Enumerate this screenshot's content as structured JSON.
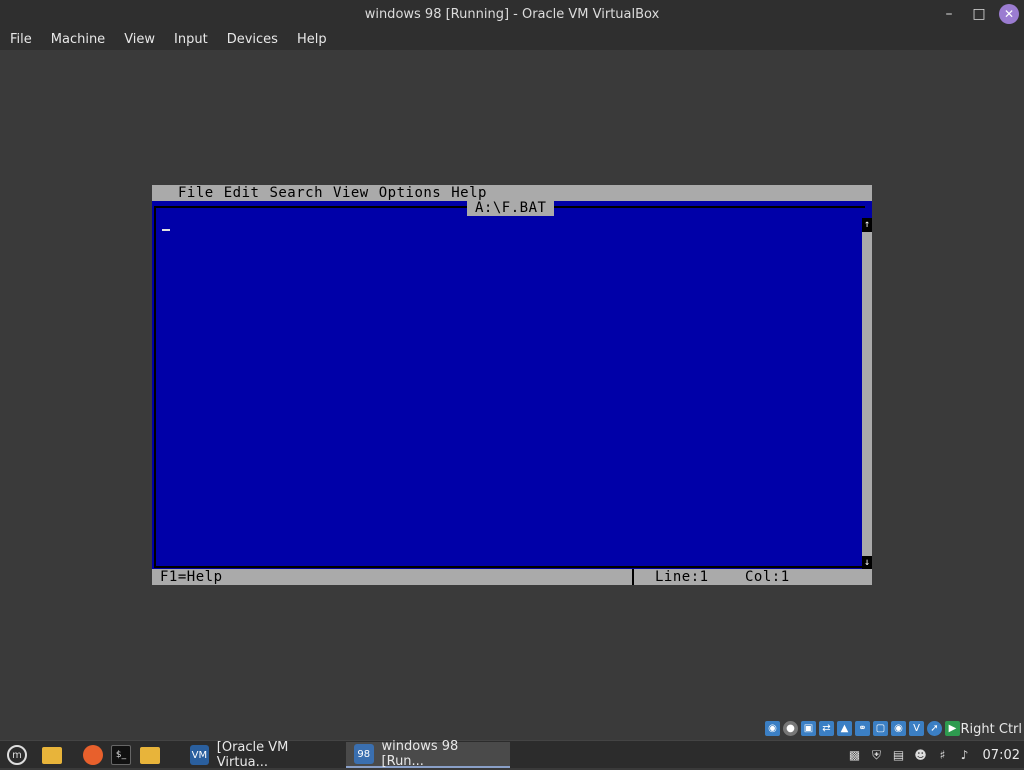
{
  "window": {
    "title": "windows 98 [Running] - Oracle VM VirtualBox",
    "minimize_icon": "minimize-icon",
    "maximize_icon": "maximize-icon",
    "close_icon": "close-icon"
  },
  "host_menu": [
    "File",
    "Machine",
    "View",
    "Input",
    "Devices",
    "Help"
  ],
  "dos_editor": {
    "menu": [
      "File",
      "Edit",
      "Search",
      "View",
      "Options",
      "Help"
    ],
    "file_title": "A:\\F.BAT",
    "status_help": "F1=Help",
    "status_line": "Line:1",
    "status_col": "Col:1",
    "colors": {
      "background": "#0000a8",
      "chrome": "#aaaaaa",
      "text": "#000000"
    }
  },
  "vbox_status": {
    "host_key_label": "Right Ctrl",
    "icons": [
      "optical-drive-icon",
      "disk-icon",
      "floppy-icon",
      "network-icon",
      "shared-folder-icon",
      "usb-icon",
      "display-icon",
      "recording-icon",
      "vt-x-icon",
      "mouse-integration-icon",
      "keyboard-icon"
    ]
  },
  "taskbar": {
    "launchers": [
      "menu-icon",
      "files-icon",
      "firefox-icon",
      "terminal-icon",
      "folder-icon"
    ],
    "tasks": [
      {
        "label": "[Oracle VM Virtua...",
        "active": false
      },
      {
        "label": "windows 98 [Run...",
        "active": true
      }
    ],
    "tray_icons": [
      "clipboard-icon",
      "shield-icon",
      "notes-icon",
      "user-icon",
      "network-icon",
      "volume-icon"
    ],
    "clock": "07:02"
  }
}
